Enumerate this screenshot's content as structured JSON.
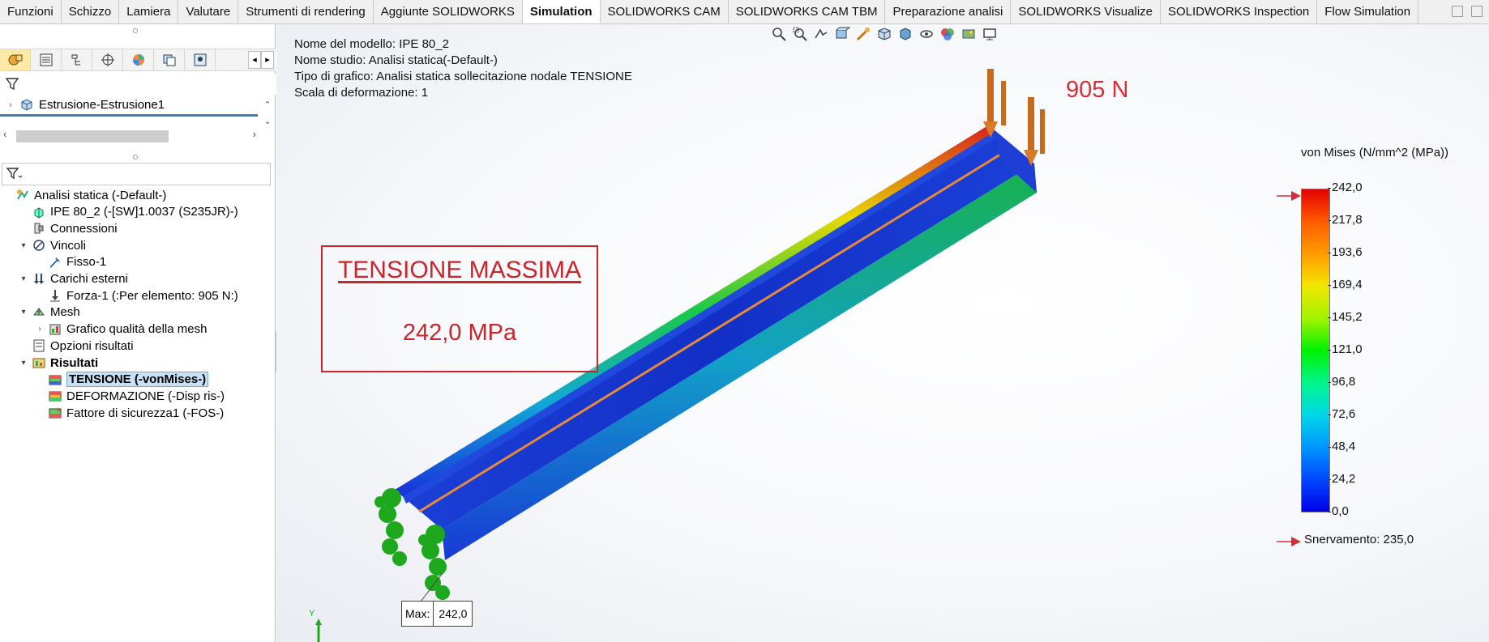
{
  "tabs": [
    {
      "label": "Funzioni",
      "active": false
    },
    {
      "label": "Schizzo",
      "active": false
    },
    {
      "label": "Lamiera",
      "active": false
    },
    {
      "label": "Valutare",
      "active": false
    },
    {
      "label": "Strumenti di rendering",
      "active": false
    },
    {
      "label": "Aggiunte SOLIDWORKS",
      "active": false
    },
    {
      "label": "Simulation",
      "active": true
    },
    {
      "label": "SOLIDWORKS CAM",
      "active": false
    },
    {
      "label": "SOLIDWORKS CAM TBM",
      "active": false
    },
    {
      "label": "Preparazione analisi",
      "active": false
    },
    {
      "label": "SOLIDWORKS Visualize",
      "active": false
    },
    {
      "label": "SOLIDWORKS Inspection",
      "active": false
    },
    {
      "label": "Flow Simulation",
      "active": false
    }
  ],
  "left_pane": {
    "pane_tab_icons": [
      "feature-manager-icon",
      "property-manager-icon",
      "configuration-manager-icon",
      "dimxpert-icon",
      "display-manager-icon",
      "cam-feature-icon",
      "cam-operation-icon"
    ],
    "top_tree_item": "Estrusione-Estrusione1",
    "study_tree": [
      {
        "label": "Analisi statica (-Default-)",
        "icon": "static-study-icon",
        "expander": "",
        "indent": 0
      },
      {
        "label": "IPE 80_2 (-[SW]1.0037 (S235JR)-)",
        "icon": "part-material-icon",
        "expander": "",
        "indent": 1
      },
      {
        "label": "Connessioni",
        "icon": "connections-icon",
        "expander": "",
        "indent": 1
      },
      {
        "label": "Vincoli",
        "icon": "fixtures-icon",
        "expander": "▾",
        "indent": 1
      },
      {
        "label": "Fisso-1",
        "icon": "fixed-geometry-icon",
        "expander": "",
        "indent": 2
      },
      {
        "label": "Carichi esterni",
        "icon": "external-loads-icon",
        "expander": "▾",
        "indent": 1
      },
      {
        "label": "Forza-1 (:Per elemento: 905 N:)",
        "icon": "force-icon",
        "expander": "",
        "indent": 2
      },
      {
        "label": "Mesh",
        "icon": "mesh-icon",
        "expander": "▾",
        "indent": 1
      },
      {
        "label": "Grafico qualità della mesh",
        "icon": "mesh-quality-plot-icon",
        "expander": "›",
        "indent": 2
      },
      {
        "label": "Opzioni risultati",
        "icon": "result-options-icon",
        "expander": "",
        "indent": 1
      },
      {
        "label": "Risultati",
        "icon": "results-folder-icon",
        "expander": "▾",
        "indent": 1,
        "bold": true
      },
      {
        "label": "TENSIONE (-vonMises-)",
        "icon": "stress-plot-icon",
        "expander": "",
        "indent": 2,
        "selected": true
      },
      {
        "label": "DEFORMAZIONE (-Disp ris-)",
        "icon": "displacement-plot-icon",
        "expander": "",
        "indent": 2
      },
      {
        "label": "Fattore di sicurezza1 (-FOS-)",
        "icon": "fos-plot-icon",
        "expander": "",
        "indent": 2
      }
    ]
  },
  "viewport": {
    "info_lines": [
      "Nome del modello: IPE 80_2",
      "Nome studio: Analisi statica(-Default-)",
      "Tipo di grafico: Analisi statica sollecitazione nodale TENSIONE",
      "Scala di deformazione: 1"
    ],
    "load_label": "905 N",
    "callout_title": "TENSIONE MASSIMA",
    "callout_value": "242,0 MPa",
    "max_probe": {
      "key": "Max:",
      "value": "242,0"
    },
    "triad_axis": "Y"
  },
  "legend": {
    "title": "von Mises (N/mm^2 (MPa))",
    "ticks": [
      "242,0",
      "217,8",
      "193,6",
      "169,4",
      "145,2",
      "121,0",
      "96,8",
      "72,6",
      "48,4",
      "24,2",
      "0,0"
    ],
    "yield_label": "Snervamento: 235,0",
    "colors": {
      "max": "#e40000",
      "min": "#0000e8",
      "marker": "#d42f37"
    }
  }
}
